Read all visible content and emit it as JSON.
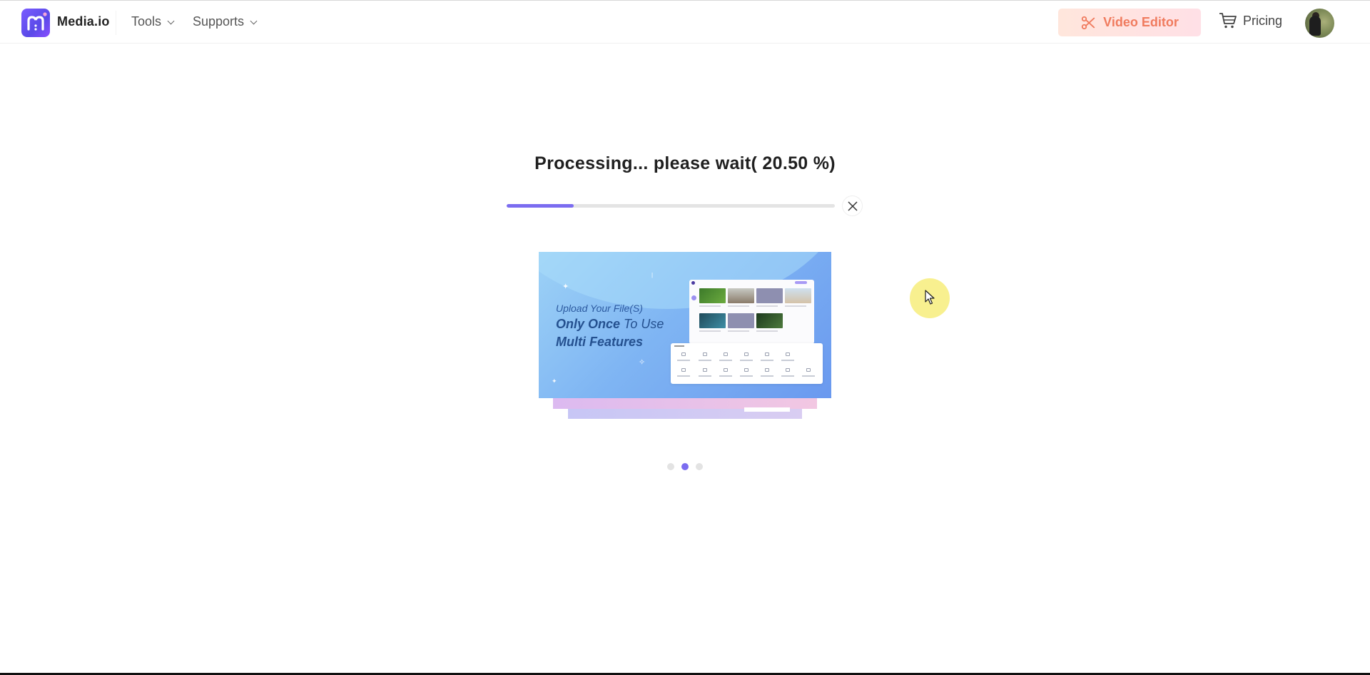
{
  "header": {
    "brand": "Media.io",
    "nav": [
      {
        "label": "Tools",
        "icon": "chevron-down-icon"
      },
      {
        "label": "Supports",
        "icon": "chevron-down-icon"
      }
    ],
    "video_editor": {
      "label": "Video Editor",
      "icon": "scissors-icon",
      "text_color": "#f07b5e"
    },
    "pricing": {
      "label": "Pricing",
      "icon": "cart-icon"
    },
    "avatar": {
      "icon": "user-avatar"
    }
  },
  "processing": {
    "title": "Processing... please wait( 20.50 %)",
    "progress_percent": 20.5,
    "accent_color": "#7b6cf0",
    "close_icon": "close-icon"
  },
  "carousel": {
    "slide": {
      "line1": "Upload Your File(S)",
      "line2_bold": "Only Once",
      "line2_rest": " To Use",
      "line3": "Multi Features"
    },
    "indicators": 3,
    "active_index": 1
  },
  "cursor": {
    "icon": "mouse-pointer-icon",
    "highlight_color": "#f8f08a"
  }
}
